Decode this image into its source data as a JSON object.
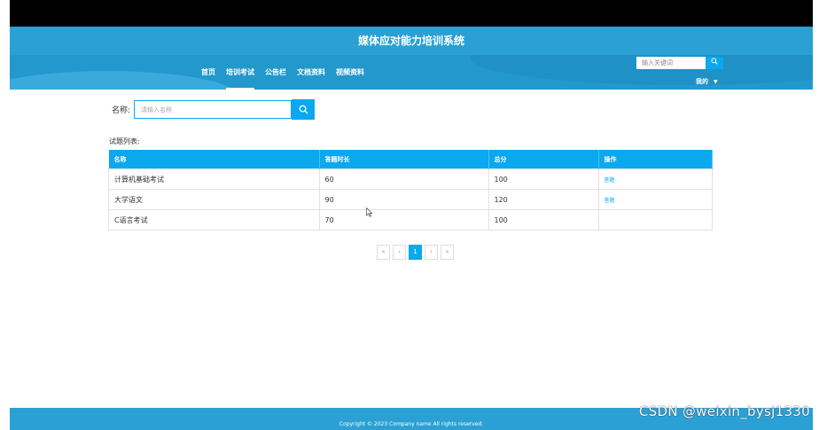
{
  "header": {
    "site_title": "媒体应对能力培训系统"
  },
  "nav": {
    "items": [
      "首页",
      "培训考试",
      "公告栏",
      "文档资料",
      "视频资料"
    ],
    "active_index": 1
  },
  "top_search": {
    "placeholder": "输入关键词",
    "icon": "search-icon"
  },
  "user_menu": {
    "label": "我的",
    "caret": "▼"
  },
  "search": {
    "label": "名称:",
    "placeholder": "请输入名称",
    "icon": "search-icon"
  },
  "list": {
    "title": "试题列表:",
    "columns": [
      "名称",
      "答题时长",
      "总分",
      "操作"
    ],
    "rows": [
      {
        "name": "计算机基础考试",
        "duration": "60",
        "score": "100",
        "action": "答题"
      },
      {
        "name": "大学语文",
        "duration": "90",
        "score": "120",
        "action": "答题"
      },
      {
        "name": "C语言考试",
        "duration": "70",
        "score": "100",
        "action": ""
      }
    ]
  },
  "pagination": {
    "first": "«",
    "prev": "‹",
    "current": "1",
    "next": "›",
    "last": "»"
  },
  "footer": {
    "copyright": "Copyright © 2023 Company name All rights reserved."
  },
  "watermark": "CSDN @weixin_bysj1330",
  "colors": {
    "header": "#2aa0d4",
    "accent": "#0aa8ee",
    "topbar": "#000000"
  }
}
